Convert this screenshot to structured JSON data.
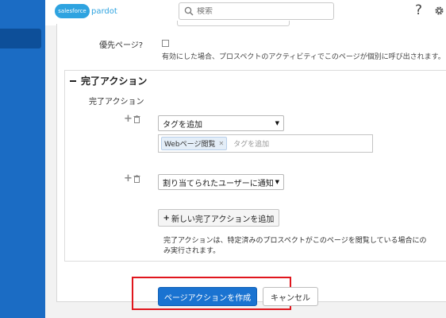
{
  "header": {
    "logo_text": "salesforce",
    "logo_product": "pardot",
    "search_placeholder": "検索",
    "help_icon": "?",
    "settings_icon": "gear-icon"
  },
  "priority": {
    "label": "優先ページ?",
    "checked": false,
    "help": "有効にした場合、プロスペクトのアクティビティでこのページが個別に呼び出されます。"
  },
  "completion": {
    "section_title": "完了アクション",
    "field_label": "完了アクション",
    "actions": [
      {
        "selected": "タグを追加",
        "tags": [
          "Webページ閲覧"
        ],
        "tag_placeholder": "タグを追加"
      },
      {
        "selected": "割り当てられたユーザーに通知"
      }
    ],
    "add_button_label": "新しい完了アクションを追加",
    "note": "完了アクションは、特定済みのプロスペクトがこのページを閲覧している場合にのみ実行されます。"
  },
  "footer": {
    "create_label": "ページアクションを作成",
    "cancel_label": "キャンセル"
  },
  "colors": {
    "nav": "#1b6cc4",
    "primary": "#1a73d1",
    "highlight": "#e0161d"
  }
}
